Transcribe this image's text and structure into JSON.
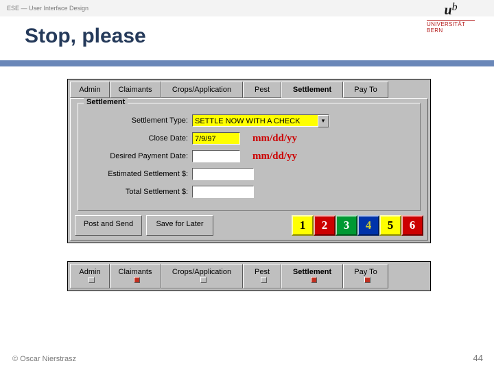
{
  "header": {
    "breadcrumb": "ESE — User Interface Design",
    "title": "Stop, please"
  },
  "logo": {
    "mark_u": "u",
    "mark_b": "b",
    "line1": "UNIVERSITÄT",
    "line2": "BERN"
  },
  "tabs": [
    {
      "label": "Admin"
    },
    {
      "label": "Claimants"
    },
    {
      "label": "Crops/Application"
    },
    {
      "label": "Pest"
    },
    {
      "label": "Settlement"
    },
    {
      "label": "Pay To"
    }
  ],
  "form": {
    "group_label": "Settlement",
    "settlement_type": {
      "label": "Settlement Type:",
      "value": "SETTLE NOW WITH A CHECK"
    },
    "close_date": {
      "label": "Close Date:",
      "value": "7/9/97",
      "hint": "mm/dd/yy"
    },
    "desired_payment": {
      "label": "Desired Payment Date:",
      "value": "",
      "hint": "mm/dd/yy"
    },
    "est_settlement": {
      "label": "Estimated Settlement $:",
      "value": ""
    },
    "total_settlement": {
      "label": "Total Settlement $:",
      "value": ""
    }
  },
  "buttons": {
    "post_send": "Post and Send",
    "save_later": "Save for Later",
    "numbers": [
      {
        "n": "1",
        "bg": "#ffff00",
        "fg": "#000000"
      },
      {
        "n": "2",
        "bg": "#cc0000",
        "fg": "#ffffff"
      },
      {
        "n": "3",
        "bg": "#009933",
        "fg": "#ffffff"
      },
      {
        "n": "4",
        "bg": "#0033aa",
        "fg": "#cccc33"
      },
      {
        "n": "5",
        "bg": "#ffff00",
        "fg": "#000000"
      },
      {
        "n": "6",
        "bg": "#cc0000",
        "fg": "#ffffff"
      }
    ]
  },
  "alt_tabs": [
    {
      "label": "Admin",
      "on": false
    },
    {
      "label": "Claimants",
      "on": true
    },
    {
      "label": "Crops/Application",
      "on": false
    },
    {
      "label": "Pest",
      "on": false
    },
    {
      "label": "Settlement",
      "on": true
    },
    {
      "label": "Pay To",
      "on": true
    }
  ],
  "footer": {
    "copyright": "© Oscar Nierstrasz",
    "page": "44"
  }
}
